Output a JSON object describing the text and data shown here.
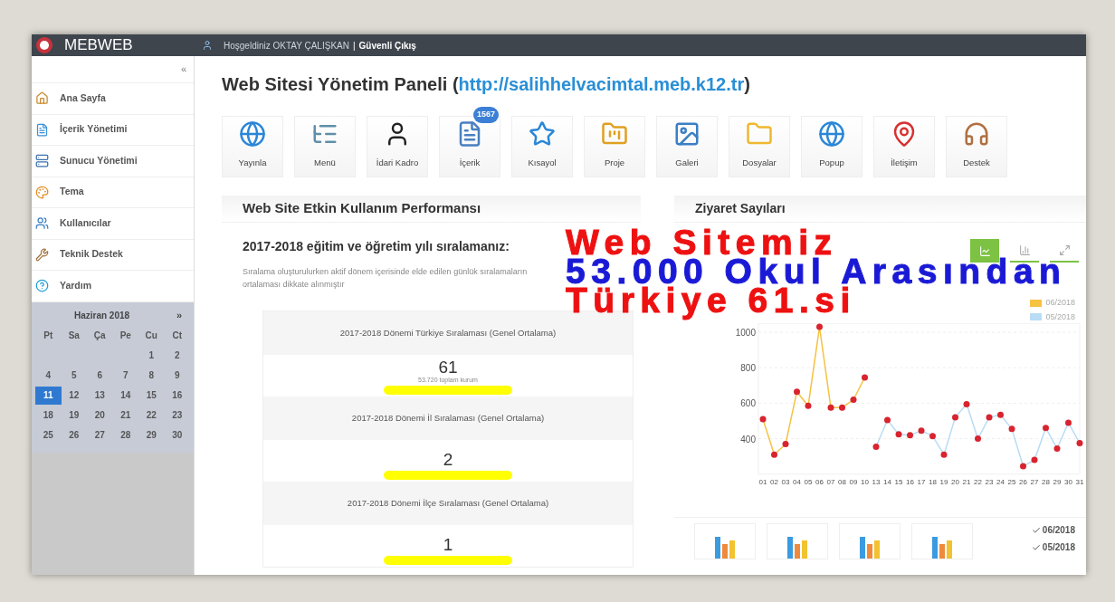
{
  "header": {
    "brand": "MEBWEB",
    "user_text": "Hoşgeldiniz OKTAY ÇALIŞKAN",
    "separator": "|",
    "logout": "Güvenli Çıkış"
  },
  "sidebar": {
    "collapse": "«",
    "items": [
      {
        "label": "Ana Sayfa"
      },
      {
        "label": "İçerik Yönetimi"
      },
      {
        "label": "Sunucu Yönetimi"
      },
      {
        "label": "Tema"
      },
      {
        "label": "Kullanıcılar"
      },
      {
        "label": "Teknik Destek"
      },
      {
        "label": "Yardım"
      }
    ]
  },
  "calendar": {
    "month": "Haziran 2018",
    "next": "»",
    "weekdays": [
      "Pt",
      "Sa",
      "Ça",
      "Pe",
      "Cu",
      "Ct"
    ],
    "weeks": [
      [
        {
          "day": "1",
          "selected": false
        },
        {
          "day": "2",
          "selected": false
        }
      ],
      [
        {
          "day": "4",
          "selected": false
        },
        {
          "day": "5",
          "selected": false
        },
        {
          "day": "6",
          "selected": false
        },
        {
          "day": "7",
          "selected": false
        },
        {
          "day": "8",
          "selected": false
        },
        {
          "day": "9",
          "selected": false
        }
      ],
      [
        {
          "day": "11",
          "selected": true
        },
        {
          "day": "12",
          "selected": false
        },
        {
          "day": "13",
          "selected": false
        },
        {
          "day": "14",
          "selected": false
        },
        {
          "day": "15",
          "selected": false
        },
        {
          "day": "16",
          "selected": false
        }
      ],
      [
        {
          "day": "18",
          "selected": false
        },
        {
          "day": "19",
          "selected": false
        },
        {
          "day": "20",
          "selected": false
        },
        {
          "day": "21",
          "selected": false
        },
        {
          "day": "22",
          "selected": false
        },
        {
          "day": "23",
          "selected": false
        }
      ],
      [
        {
          "day": "25",
          "selected": false
        },
        {
          "day": "26",
          "selected": false
        },
        {
          "day": "27",
          "selected": false
        },
        {
          "day": "28",
          "selected": false
        },
        {
          "day": "29",
          "selected": false
        },
        {
          "day": "30",
          "selected": false
        }
      ]
    ]
  },
  "page_title": {
    "text": "Web Sitesi Yönetim Paneli (",
    "link": "http://salihhelvacimtal.meb.k12.tr",
    "close": ")"
  },
  "shortcuts": [
    {
      "label": "Yayınla"
    },
    {
      "label": "Menü"
    },
    {
      "label": "İdari Kadro"
    },
    {
      "label": "İçerik",
      "badge": "1567"
    },
    {
      "label": "Kısayol"
    },
    {
      "label": "Proje"
    },
    {
      "label": "Galeri"
    },
    {
      "label": "Dosyalar"
    },
    {
      "label": "Popup"
    },
    {
      "label": "İletişim"
    },
    {
      "label": "Destek"
    }
  ],
  "performance": {
    "title": "Web Site Etkin Kullanım Performansı",
    "subtitle": "2017-2018 eğitim ve öğretim yılı sıralamanız:",
    "description": "Sıralama oluşturulurken aktif dönem içerisinde elde edilen günlük sıralamaların ortalaması dikkate alınmıştır",
    "rankings": [
      {
        "label": "2017-2018 Dönemi Türkiye Sıralaması (Genel Ortalama)",
        "value": "61",
        "note": "53.720 toplam kurum"
      },
      {
        "label": "2017-2018 Dönemi İl Sıralaması (Genel Ortalama)",
        "value": "2"
      },
      {
        "label": "2017-2018 Dönemi İlçe Sıralaması (Genel Ortalama)",
        "value": "1"
      }
    ]
  },
  "visits": {
    "title": "Ziyaret Sayıları",
    "toolbar": [
      {
        "selected": true
      },
      {
        "selected": false
      },
      {
        "selected": false
      }
    ],
    "chart_data": {
      "type": "line",
      "categories": [
        "01",
        "02",
        "03",
        "04",
        "05",
        "06",
        "07",
        "08",
        "09",
        "10",
        "13",
        "14",
        "15",
        "16",
        "17",
        "18",
        "19",
        "20",
        "21",
        "22",
        "23",
        "24",
        "25",
        "26",
        "27",
        "28",
        "29",
        "30",
        "31"
      ],
      "ylim": [
        200,
        1050
      ],
      "yticks": [
        400,
        600,
        800,
        1000
      ],
      "grid": true,
      "series": [
        {
          "name": "06/2018",
          "color": "#f5c242",
          "marker": "circle",
          "values": [
            510,
            310,
            370,
            665,
            585,
            1030,
            575,
            575,
            620,
            745,
            null,
            null,
            null,
            null,
            null,
            null,
            null,
            null,
            null,
            null,
            null,
            null,
            null,
            null,
            null,
            null,
            null,
            null,
            null
          ]
        },
        {
          "name": "05/2018",
          "color": "#b8dcf5",
          "marker": "circle",
          "values": [
            null,
            null,
            null,
            null,
            null,
            null,
            null,
            null,
            null,
            null,
            355,
            505,
            425,
            420,
            445,
            415,
            310,
            520,
            595,
            400,
            520,
            535,
            455,
            245,
            280,
            460,
            345,
            490,
            375
          ]
        }
      ]
    },
    "legend_toggles": [
      {
        "label": "06/2018",
        "checked": true
      },
      {
        "label": "05/2018",
        "checked": true
      }
    ]
  },
  "overlay": [
    {
      "text": "Web Sitemiz",
      "color": "#ee1111"
    },
    {
      "text": "53.000 Okul Arasından",
      "color": "#1a1ad6"
    },
    {
      "text": "Türkiye 61.si",
      "color": "#ee1111"
    }
  ]
}
